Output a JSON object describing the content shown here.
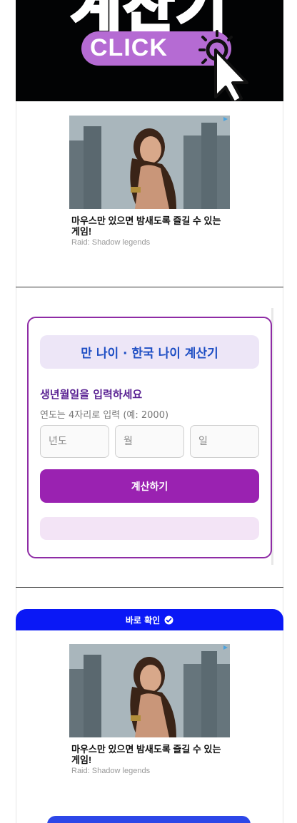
{
  "banner": {
    "title_fragment": "계산기",
    "click_label": "CLICK"
  },
  "ads": [
    {
      "title": "마우스만 있으면 밤새도록 즐길 수 있는 게임!",
      "source": "Raid: Shadow legends"
    },
    {
      "title": "마우스만 있으면 밤새도록 즐길 수 있는 게임!",
      "source": "Raid: Shadow legends"
    }
  ],
  "calculator": {
    "title": "만 나이 · 한국 나이 계산기",
    "prompt": "생년월일을 입력하세요",
    "hint": "연도는 4자리로 입력 (예: 2000)",
    "year_placeholder": "년도",
    "month_placeholder": "월",
    "day_placeholder": "일",
    "year_value": "",
    "month_value": "",
    "day_value": "",
    "button_label": "계산하기",
    "result": ""
  },
  "confirm": {
    "label": "바로 확인"
  },
  "colors": {
    "accent_purple": "#9a22b1",
    "header_blue": "#1f4fc4",
    "confirm_blue": "#0a18f6"
  }
}
